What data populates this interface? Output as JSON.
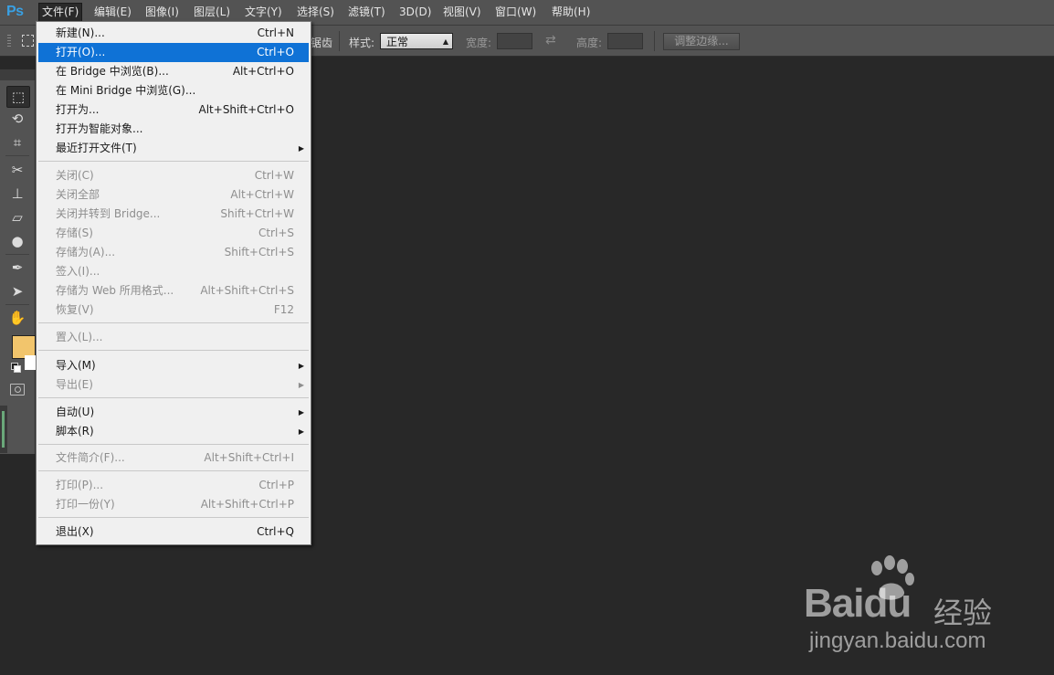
{
  "app": {
    "logo": "Ps"
  },
  "menubar": {
    "items": [
      {
        "label": "文件(F)"
      },
      {
        "label": "编辑(E)"
      },
      {
        "label": "图像(I)"
      },
      {
        "label": "图层(L)"
      },
      {
        "label": "文字(Y)"
      },
      {
        "label": "选择(S)"
      },
      {
        "label": "滤镜(T)"
      },
      {
        "label": "3D(D)"
      },
      {
        "label": "视图(V)"
      },
      {
        "label": "窗口(W)"
      },
      {
        "label": "帮助(H)"
      }
    ]
  },
  "options": {
    "clipped_label": "锯齿",
    "style_label": "样式:",
    "style_value": "正常",
    "width_label": "宽度:",
    "height_label": "高度:",
    "refine_label": "调整边缘..."
  },
  "tools": {
    "foreground_color": "#f2c56c",
    "background_color": "#ffffff",
    "icons": [
      "marquee-icon",
      "lasso-icon",
      "crop-icon",
      "healing-icon",
      "stamp-icon",
      "eraser-icon",
      "blur-icon",
      "pen-icon",
      "path-select-icon",
      "hand-icon"
    ]
  },
  "file_menu": {
    "items": [
      {
        "label": "新建(N)...",
        "shortcut": "Ctrl+N"
      },
      {
        "label": "打开(O)...",
        "shortcut": "Ctrl+O"
      },
      {
        "label": "在 Bridge 中浏览(B)...",
        "shortcut": "Alt+Ctrl+O"
      },
      {
        "label": "在 Mini Bridge 中浏览(G)...",
        "shortcut": ""
      },
      {
        "label": "打开为...",
        "shortcut": "Alt+Shift+Ctrl+O"
      },
      {
        "label": "打开为智能对象...",
        "shortcut": ""
      },
      {
        "label": "最近打开文件(T)",
        "shortcut": ""
      },
      {
        "label": "关闭(C)",
        "shortcut": "Ctrl+W"
      },
      {
        "label": "关闭全部",
        "shortcut": "Alt+Ctrl+W"
      },
      {
        "label": "关闭并转到 Bridge...",
        "shortcut": "Shift+Ctrl+W"
      },
      {
        "label": "存储(S)",
        "shortcut": "Ctrl+S"
      },
      {
        "label": "存储为(A)...",
        "shortcut": "Shift+Ctrl+S"
      },
      {
        "label": "签入(I)...",
        "shortcut": ""
      },
      {
        "label": "存储为 Web 所用格式...",
        "shortcut": "Alt+Shift+Ctrl+S"
      },
      {
        "label": "恢复(V)",
        "shortcut": "F12"
      },
      {
        "label": "置入(L)...",
        "shortcut": ""
      },
      {
        "label": "导入(M)",
        "shortcut": ""
      },
      {
        "label": "导出(E)",
        "shortcut": ""
      },
      {
        "label": "自动(U)",
        "shortcut": ""
      },
      {
        "label": "脚本(R)",
        "shortcut": ""
      },
      {
        "label": "文件简介(F)...",
        "shortcut": "Alt+Shift+Ctrl+I"
      },
      {
        "label": "打印(P)...",
        "shortcut": "Ctrl+P"
      },
      {
        "label": "打印一份(Y)",
        "shortcut": "Alt+Shift+Ctrl+P"
      },
      {
        "label": "退出(X)",
        "shortcut": "Ctrl+Q"
      }
    ],
    "highlight_color": "#0f72d6"
  },
  "watermark": {
    "brand": "Baidu",
    "cn": "经验",
    "url": "jingyan.baidu.com"
  }
}
